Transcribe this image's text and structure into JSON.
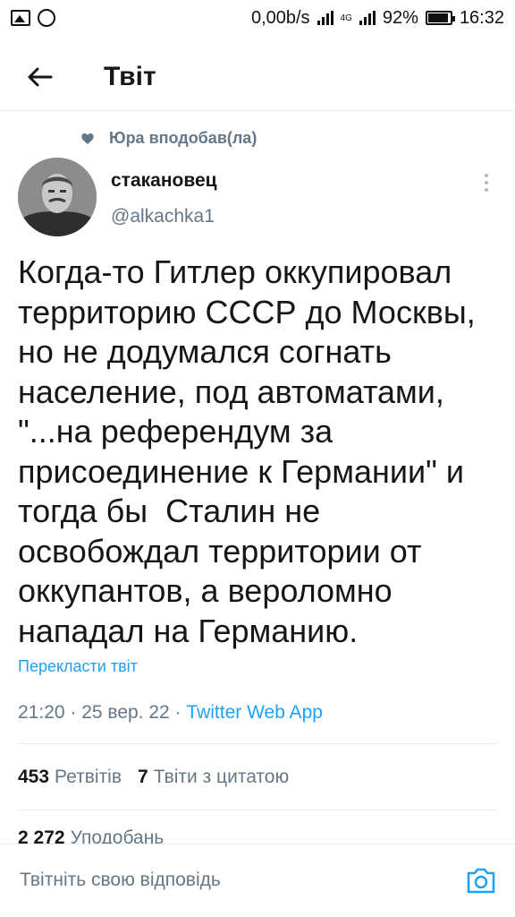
{
  "status_bar": {
    "speed": "0,00b/s",
    "network": "4G",
    "battery": "92%",
    "time": "16:32"
  },
  "header": {
    "title": "Твіт",
    "back_icon": "arrow-left-icon"
  },
  "liked_by": {
    "text": "Юра вподобав(ла)",
    "icon": "heart-icon"
  },
  "author": {
    "name": "стакановец",
    "handle": "@alkachka1"
  },
  "tweet": {
    "lines": [
      "Когда-то Гитлер оккупировал",
      "территорию СССР до Москвы,",
      "но не додумался согнать",
      "население, под автоматами,",
      "\"...на референдум за",
      "присоединение к Германии\" и",
      "тогда бы  Сталин не",
      "освобождал территории от",
      "оккупантов, а вероломно",
      "нападал на Германию."
    ],
    "translate_label": "Перекласти твіт",
    "time": "21:20",
    "date": "25 вер. 22",
    "source": "Twitter Web App"
  },
  "stats": {
    "retweets_count": "453",
    "retweets_label": "Ретвітів",
    "quotes_count": "7",
    "quotes_label": "Твіти з цитатою",
    "likes_count": "2 272",
    "likes_label": "Уподобань"
  },
  "reply": {
    "placeholder": "Твітніть свою відповідь",
    "camera_icon": "camera-icon"
  },
  "colors": {
    "accent": "#1da1f2",
    "secondary_text": "#657786",
    "primary_text": "#14171a",
    "divider": "#e6ecf0"
  }
}
